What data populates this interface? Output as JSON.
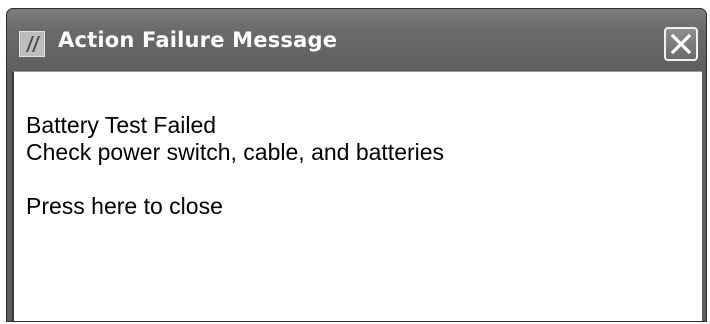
{
  "window": {
    "title": "Action Failure Message",
    "icon": "app-logo-icon",
    "close_icon": "close-icon"
  },
  "message": {
    "line1": "Battery Test Failed",
    "line2": "Check power switch, cable, and batteries",
    "close_text": "Press here to close"
  },
  "colors": {
    "titlebar": "#6a6a6a",
    "title_text": "#ffffff",
    "background": "#ffffff",
    "text": "#000000"
  }
}
